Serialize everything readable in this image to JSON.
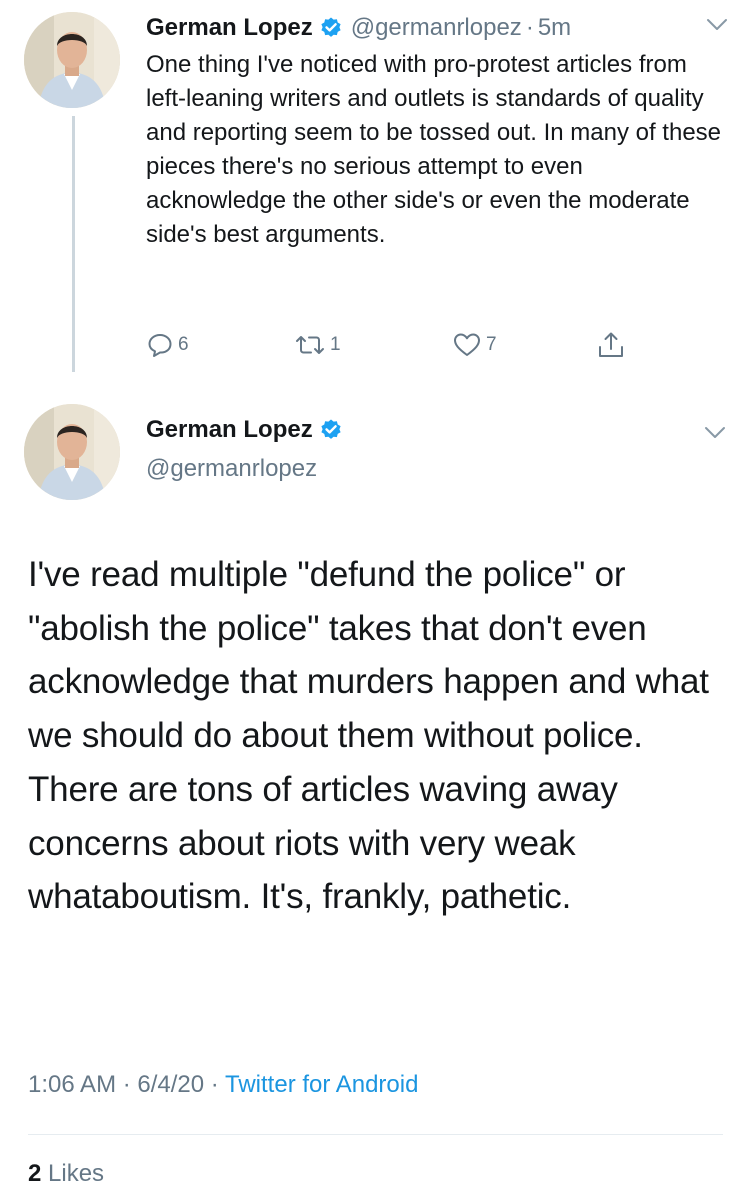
{
  "tweet1": {
    "author_name": "German Lopez",
    "handle": "@germanrlopez",
    "separator": "·",
    "time": "5m",
    "text": "One thing I've noticed with pro-protest articles from left-leaning writers and outlets is standards of quality and reporting seem to be tossed out. In many of these pieces there's no serious attempt to even acknowledge the other side's or even the moderate side's best arguments.",
    "actions": {
      "replies": "6",
      "retweets": "1",
      "likes": "7"
    }
  },
  "tweet2": {
    "author_name": "German Lopez",
    "handle": "@germanrlopez",
    "text": "I've read multiple \"defund the police\" or \"abolish the police\" takes that don't even acknowledge that murders happen and what we should do about them without police. There are tons of articles waving away concerns about riots with very weak whataboutism. It's, frankly, pathetic.",
    "timestamp": "1:06 AM · 6/4/20 · ",
    "source": "Twitter for Android",
    "likes_count": "2",
    "likes_label": " Likes"
  },
  "colors": {
    "text": "#14171a",
    "secondary": "#657786",
    "link": "#1b95e0",
    "verified": "#1da1f2",
    "divider": "#e6ecf0",
    "thread_line": "#ccd6dd"
  },
  "icons": [
    "reply-icon",
    "retweet-icon",
    "like-icon",
    "share-icon",
    "verified-badge-icon",
    "chevron-down-icon"
  ]
}
